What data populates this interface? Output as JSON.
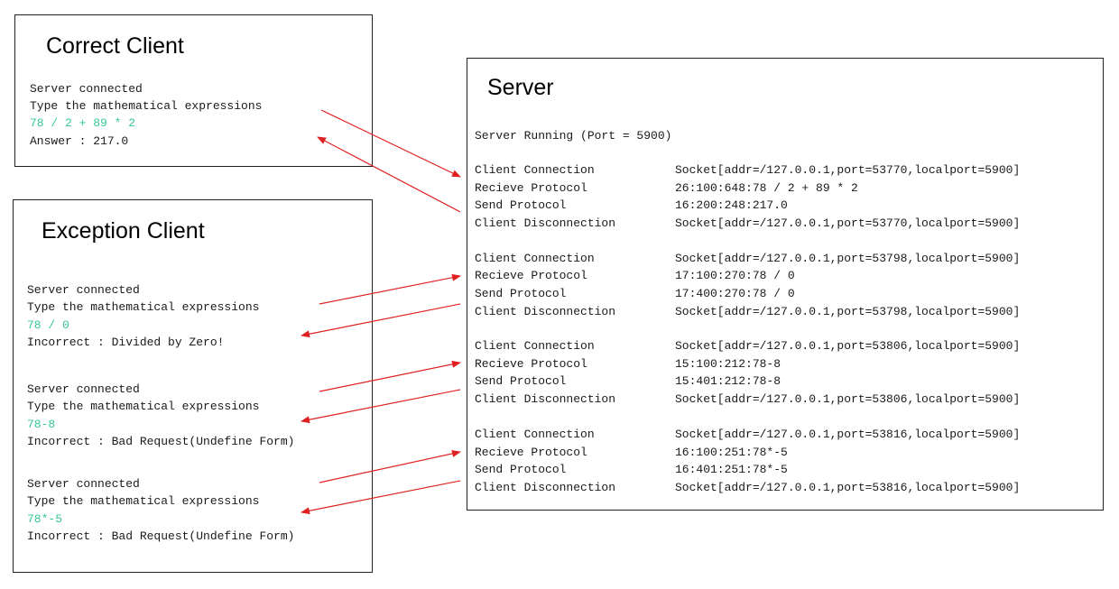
{
  "correct": {
    "title": "Correct Client",
    "lines": [
      {
        "text": "Server connected",
        "input": false
      },
      {
        "text": "Type the mathematical expressions",
        "input": false
      },
      {
        "text": "78 / 2 + 89 * 2",
        "input": true
      },
      {
        "text": "Answer : 217.0",
        "input": false
      }
    ]
  },
  "exception": {
    "title": "Exception Client",
    "groups": [
      {
        "lines": [
          {
            "text": "Server connected",
            "input": false
          },
          {
            "text": "Type the mathematical expressions",
            "input": false
          },
          {
            "text": "78 / 0",
            "input": true
          },
          {
            "text": "Incorrect : Divided by Zero!",
            "input": false
          }
        ]
      },
      {
        "lines": [
          {
            "text": "Server connected",
            "input": false
          },
          {
            "text": "Type the mathematical expressions",
            "input": false
          },
          {
            "text": "78-8",
            "input": true
          },
          {
            "text": "Incorrect : Bad Request(Undefine Form)",
            "input": false
          }
        ]
      },
      {
        "lines": [
          {
            "text": "Server connected",
            "input": false
          },
          {
            "text": "Type the mathematical expressions",
            "input": false
          },
          {
            "text": "78*-5",
            "input": true
          },
          {
            "text": "Incorrect : Bad Request(Undefine Form)",
            "input": false
          }
        ]
      }
    ]
  },
  "server": {
    "title": "Server",
    "running": "Server Running (Port = 5900)",
    "blocks": [
      {
        "rows": [
          {
            "label": "Client Connection",
            "value": "Socket[addr=/127.0.0.1,port=53770,localport=5900]"
          },
          {
            "label": "Recieve Protocol",
            "value": "26:100:648:78 / 2 + 89 * 2"
          },
          {
            "label": "Send Protocol",
            "value": "16:200:248:217.0"
          },
          {
            "label": "Client Disconnection",
            "value": "Socket[addr=/127.0.0.1,port=53770,localport=5900]"
          }
        ]
      },
      {
        "rows": [
          {
            "label": "Client Connection",
            "value": "Socket[addr=/127.0.0.1,port=53798,localport=5900]"
          },
          {
            "label": "Recieve Protocol",
            "value": "17:100:270:78 / 0"
          },
          {
            "label": "Send Protocol",
            "value": "17:400:270:78 / 0"
          },
          {
            "label": "Client Disconnection",
            "value": "Socket[addr=/127.0.0.1,port=53798,localport=5900]"
          }
        ]
      },
      {
        "rows": [
          {
            "label": "Client Connection",
            "value": "Socket[addr=/127.0.0.1,port=53806,localport=5900]"
          },
          {
            "label": "Recieve Protocol",
            "value": "15:100:212:78-8"
          },
          {
            "label": "Send Protocol",
            "value": "15:401:212:78-8"
          },
          {
            "label": "Client Disconnection",
            "value": "Socket[addr=/127.0.0.1,port=53806,localport=5900]"
          }
        ]
      },
      {
        "rows": [
          {
            "label": "Client Connection",
            "value": "Socket[addr=/127.0.0.1,port=53816,localport=5900]"
          },
          {
            "label": "Recieve Protocol",
            "value": "16:100:251:78*-5"
          },
          {
            "label": "Send Protocol",
            "value": "16:401:251:78*-5"
          },
          {
            "label": "Client Disconnection",
            "value": "Socket[addr=/127.0.0.1,port=53816,localport=5900]"
          }
        ]
      }
    ]
  },
  "colors": {
    "text": "#1a1a1a",
    "input": "#34c79a",
    "arrow": "#e02020",
    "border": "#222222"
  }
}
